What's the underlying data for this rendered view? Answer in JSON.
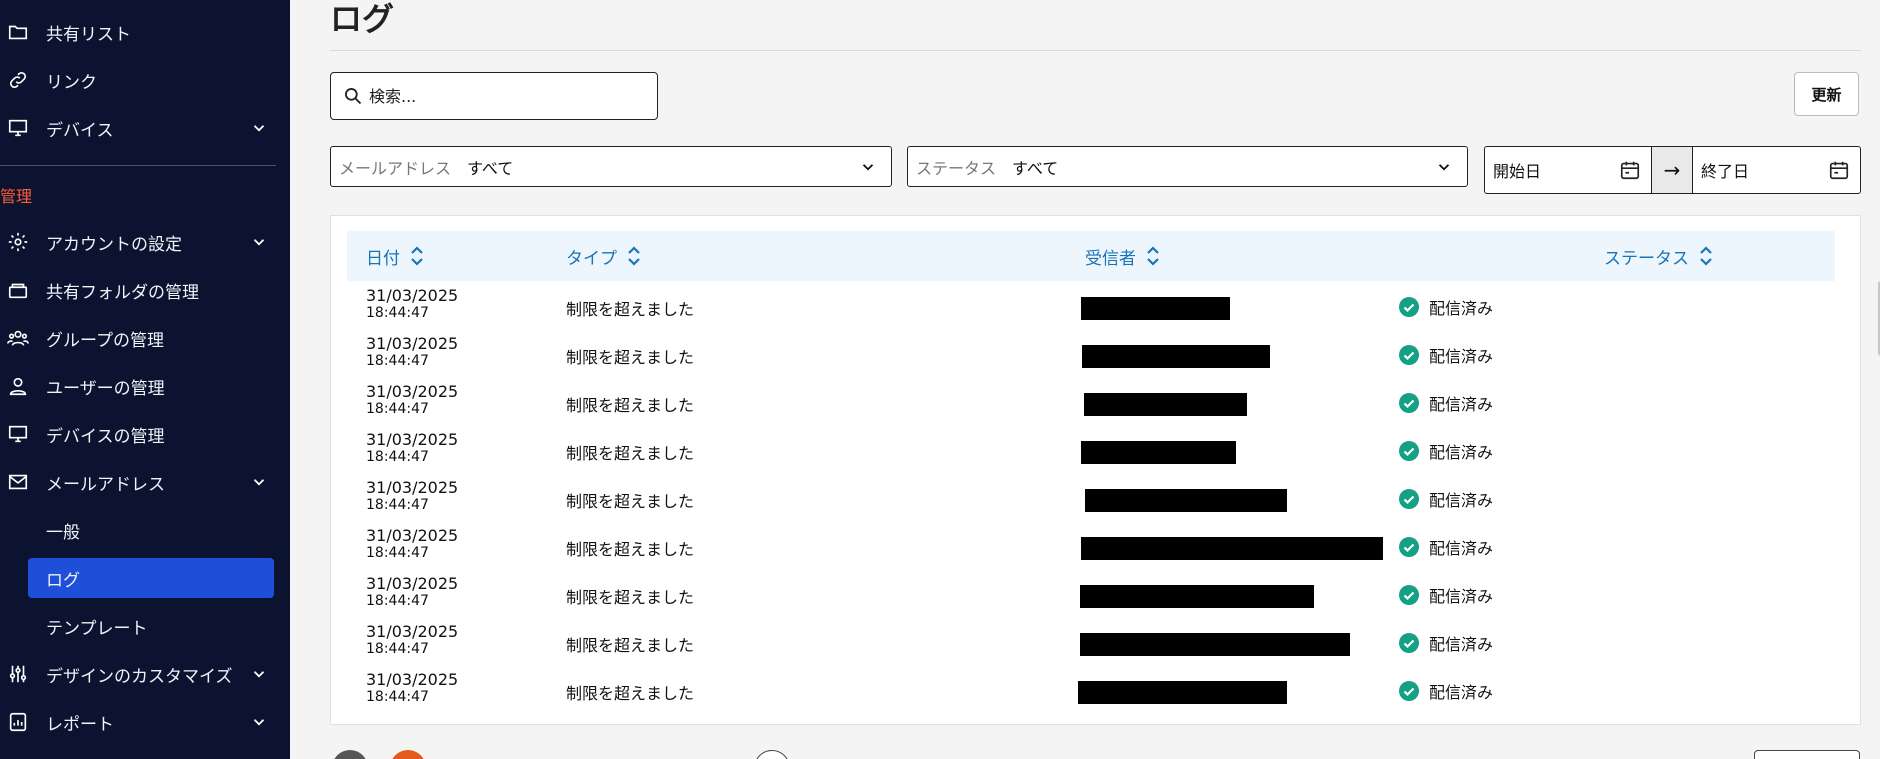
{
  "sidebar": {
    "items_top": [
      {
        "label": "共有リスト",
        "icon": "folder-icon"
      },
      {
        "label": "リンク",
        "icon": "link-icon"
      },
      {
        "label": "デバイス",
        "icon": "monitor-icon",
        "expandable": true
      }
    ],
    "section_label": "管理",
    "admin_items": [
      {
        "label": "アカウントの設定",
        "icon": "gear-icon",
        "expandable": true
      },
      {
        "label": "共有フォルダの管理",
        "icon": "shared-folder-icon"
      },
      {
        "label": "グループの管理",
        "icon": "group-icon"
      },
      {
        "label": "ユーザーの管理",
        "icon": "users-icon"
      },
      {
        "label": "デバイスの管理",
        "icon": "monitor-icon"
      },
      {
        "label": "メールアドレス",
        "icon": "mail-icon",
        "expandable": true
      }
    ],
    "mail_sub_items": [
      "一般",
      "ログ",
      "テンプレート"
    ],
    "active_sub_item": "ログ",
    "items_bottom": [
      {
        "label": "デザインのカスタマイズ",
        "icon": "sliders-icon",
        "expandable": true
      },
      {
        "label": "レポート",
        "icon": "report-icon",
        "expandable": true
      }
    ]
  },
  "page": {
    "title": "ログ",
    "search_placeholder": "検索...",
    "refresh_label": "更新"
  },
  "filters": {
    "email": {
      "label": "メールアドレス",
      "value": "すべて"
    },
    "status": {
      "label": "ステータス",
      "value": "すべて"
    },
    "start_date_placeholder": "開始日",
    "end_date_placeholder": "終了日",
    "range_arrow": "→"
  },
  "table": {
    "columns": [
      "日付",
      "タイプ",
      "受信者",
      "ステータス"
    ],
    "rows": [
      {
        "date": "31/03/2025",
        "time": "18:44:47",
        "type": "制限を超えました",
        "recipient_redacted": true,
        "status": "配信済み"
      },
      {
        "date": "31/03/2025",
        "time": "18:44:47",
        "type": "制限を超えました",
        "recipient_redacted": true,
        "status": "配信済み"
      },
      {
        "date": "31/03/2025",
        "time": "18:44:47",
        "type": "制限を超えました",
        "recipient_redacted": true,
        "status": "配信済み"
      },
      {
        "date": "31/03/2025",
        "time": "18:44:47",
        "type": "制限を超えました",
        "recipient_redacted": true,
        "status": "配信済み"
      },
      {
        "date": "31/03/2025",
        "time": "18:44:47",
        "type": "制限を超えました",
        "recipient_redacted": true,
        "status": "配信済み"
      },
      {
        "date": "31/03/2025",
        "time": "18:44:47",
        "type": "制限を超えました",
        "recipient_redacted": true,
        "status": "配信済み"
      },
      {
        "date": "31/03/2025",
        "time": "18:44:47",
        "type": "制限を超えました",
        "recipient_redacted": true,
        "status": "配信済み"
      },
      {
        "date": "31/03/2025",
        "time": "18:44:47",
        "type": "制限を超えました",
        "recipient_redacted": true,
        "status": "配信済み"
      },
      {
        "date": "31/03/2025",
        "time": "18:44:47",
        "type": "制限を超えました",
        "recipient_redacted": true,
        "status": "配信済み"
      }
    ]
  },
  "colors": {
    "sidebar_bg": "#0b1330",
    "active_bg": "#1f4fd8",
    "section_label": "#ff5c35",
    "header_text": "#1774b7",
    "status_ok": "#14a085"
  }
}
